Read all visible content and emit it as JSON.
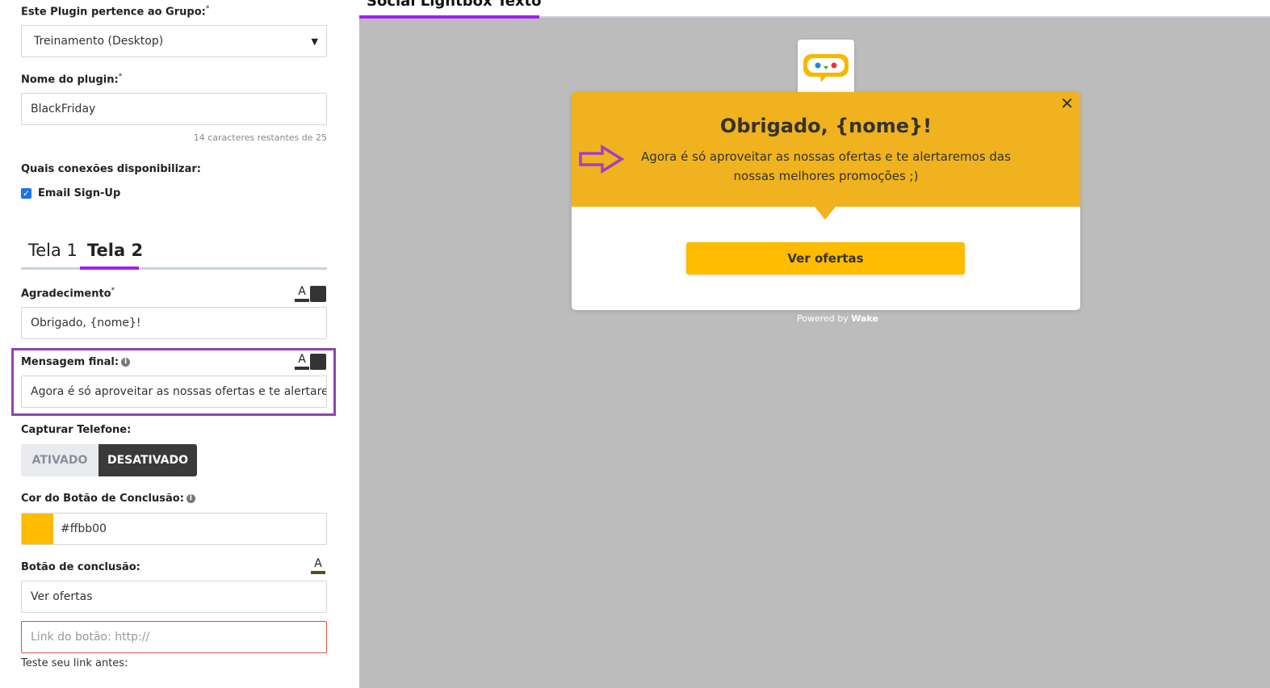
{
  "form": {
    "group_label": "Este Plugin pertence ao Grupo:",
    "group_required": "*",
    "group_value": "Treinamento (Desktop)",
    "name_label": "Nome do plugin:",
    "name_required": "*",
    "name_value": "BlackFriday",
    "name_hint": "14 caracteres restantes de 25",
    "connections_label": "Quais conexões disponibilizar:",
    "connections": [
      {
        "label": "Email Sign-Up",
        "checked": true
      }
    ],
    "tabs": [
      {
        "label": "Tela 1",
        "active": false
      },
      {
        "label": "Tela 2",
        "active": true
      }
    ],
    "thanks_label": "Agradecimento",
    "thanks_required": "*",
    "thanks_value": "Obrigado, {nome}!",
    "final_msg_label": "Mensagem final:",
    "final_msg_value": "Agora é só aproveitar as nossas ofertas e te alertaremos das nossas melhores promoções ;)",
    "phone_label": "Capturar Telefone:",
    "phone_on_label": "ATIVADO",
    "phone_off_label": "DESATIVADO",
    "phone_selected": "DESATIVADO",
    "button_color_label": "Cor do Botão de Conclusão:",
    "button_color_value": "#ffbb00",
    "conclusion_label": "Botão de conclusão:",
    "conclusion_value": "Ver ofertas",
    "link_placeholder": "Link do botão: http://",
    "link_test_label": "Teste seu link antes:",
    "format_icon_letter": "A"
  },
  "preview": {
    "title": "Social Lightbox Texto",
    "close_glyph": "✕",
    "popup_title": "Obrigado, {nome}!",
    "popup_message": "Agora é só aproveitar as nossas ofertas e te alertaremos das nossas melhores promoções ;)",
    "cta_label": "Ver ofertas",
    "powered_prefix": "Powered by",
    "powered_brand": "Wake"
  },
  "colors": {
    "accent": "#a020f0",
    "highlight_box": "#8e44ad",
    "popup_header": "#f0b21e",
    "cta": "#ffbb00",
    "preview_bg": "#bcbcbc",
    "error_border": "#e74c3c"
  },
  "icons": {
    "format_text": "text-format-icon",
    "format_color": "color-swatch-icon",
    "info": "info-icon",
    "close": "close-icon",
    "arrow": "arrow-right-icon",
    "logo": "chat-bubble-logo-icon",
    "chevron": "chevron-down-icon"
  }
}
